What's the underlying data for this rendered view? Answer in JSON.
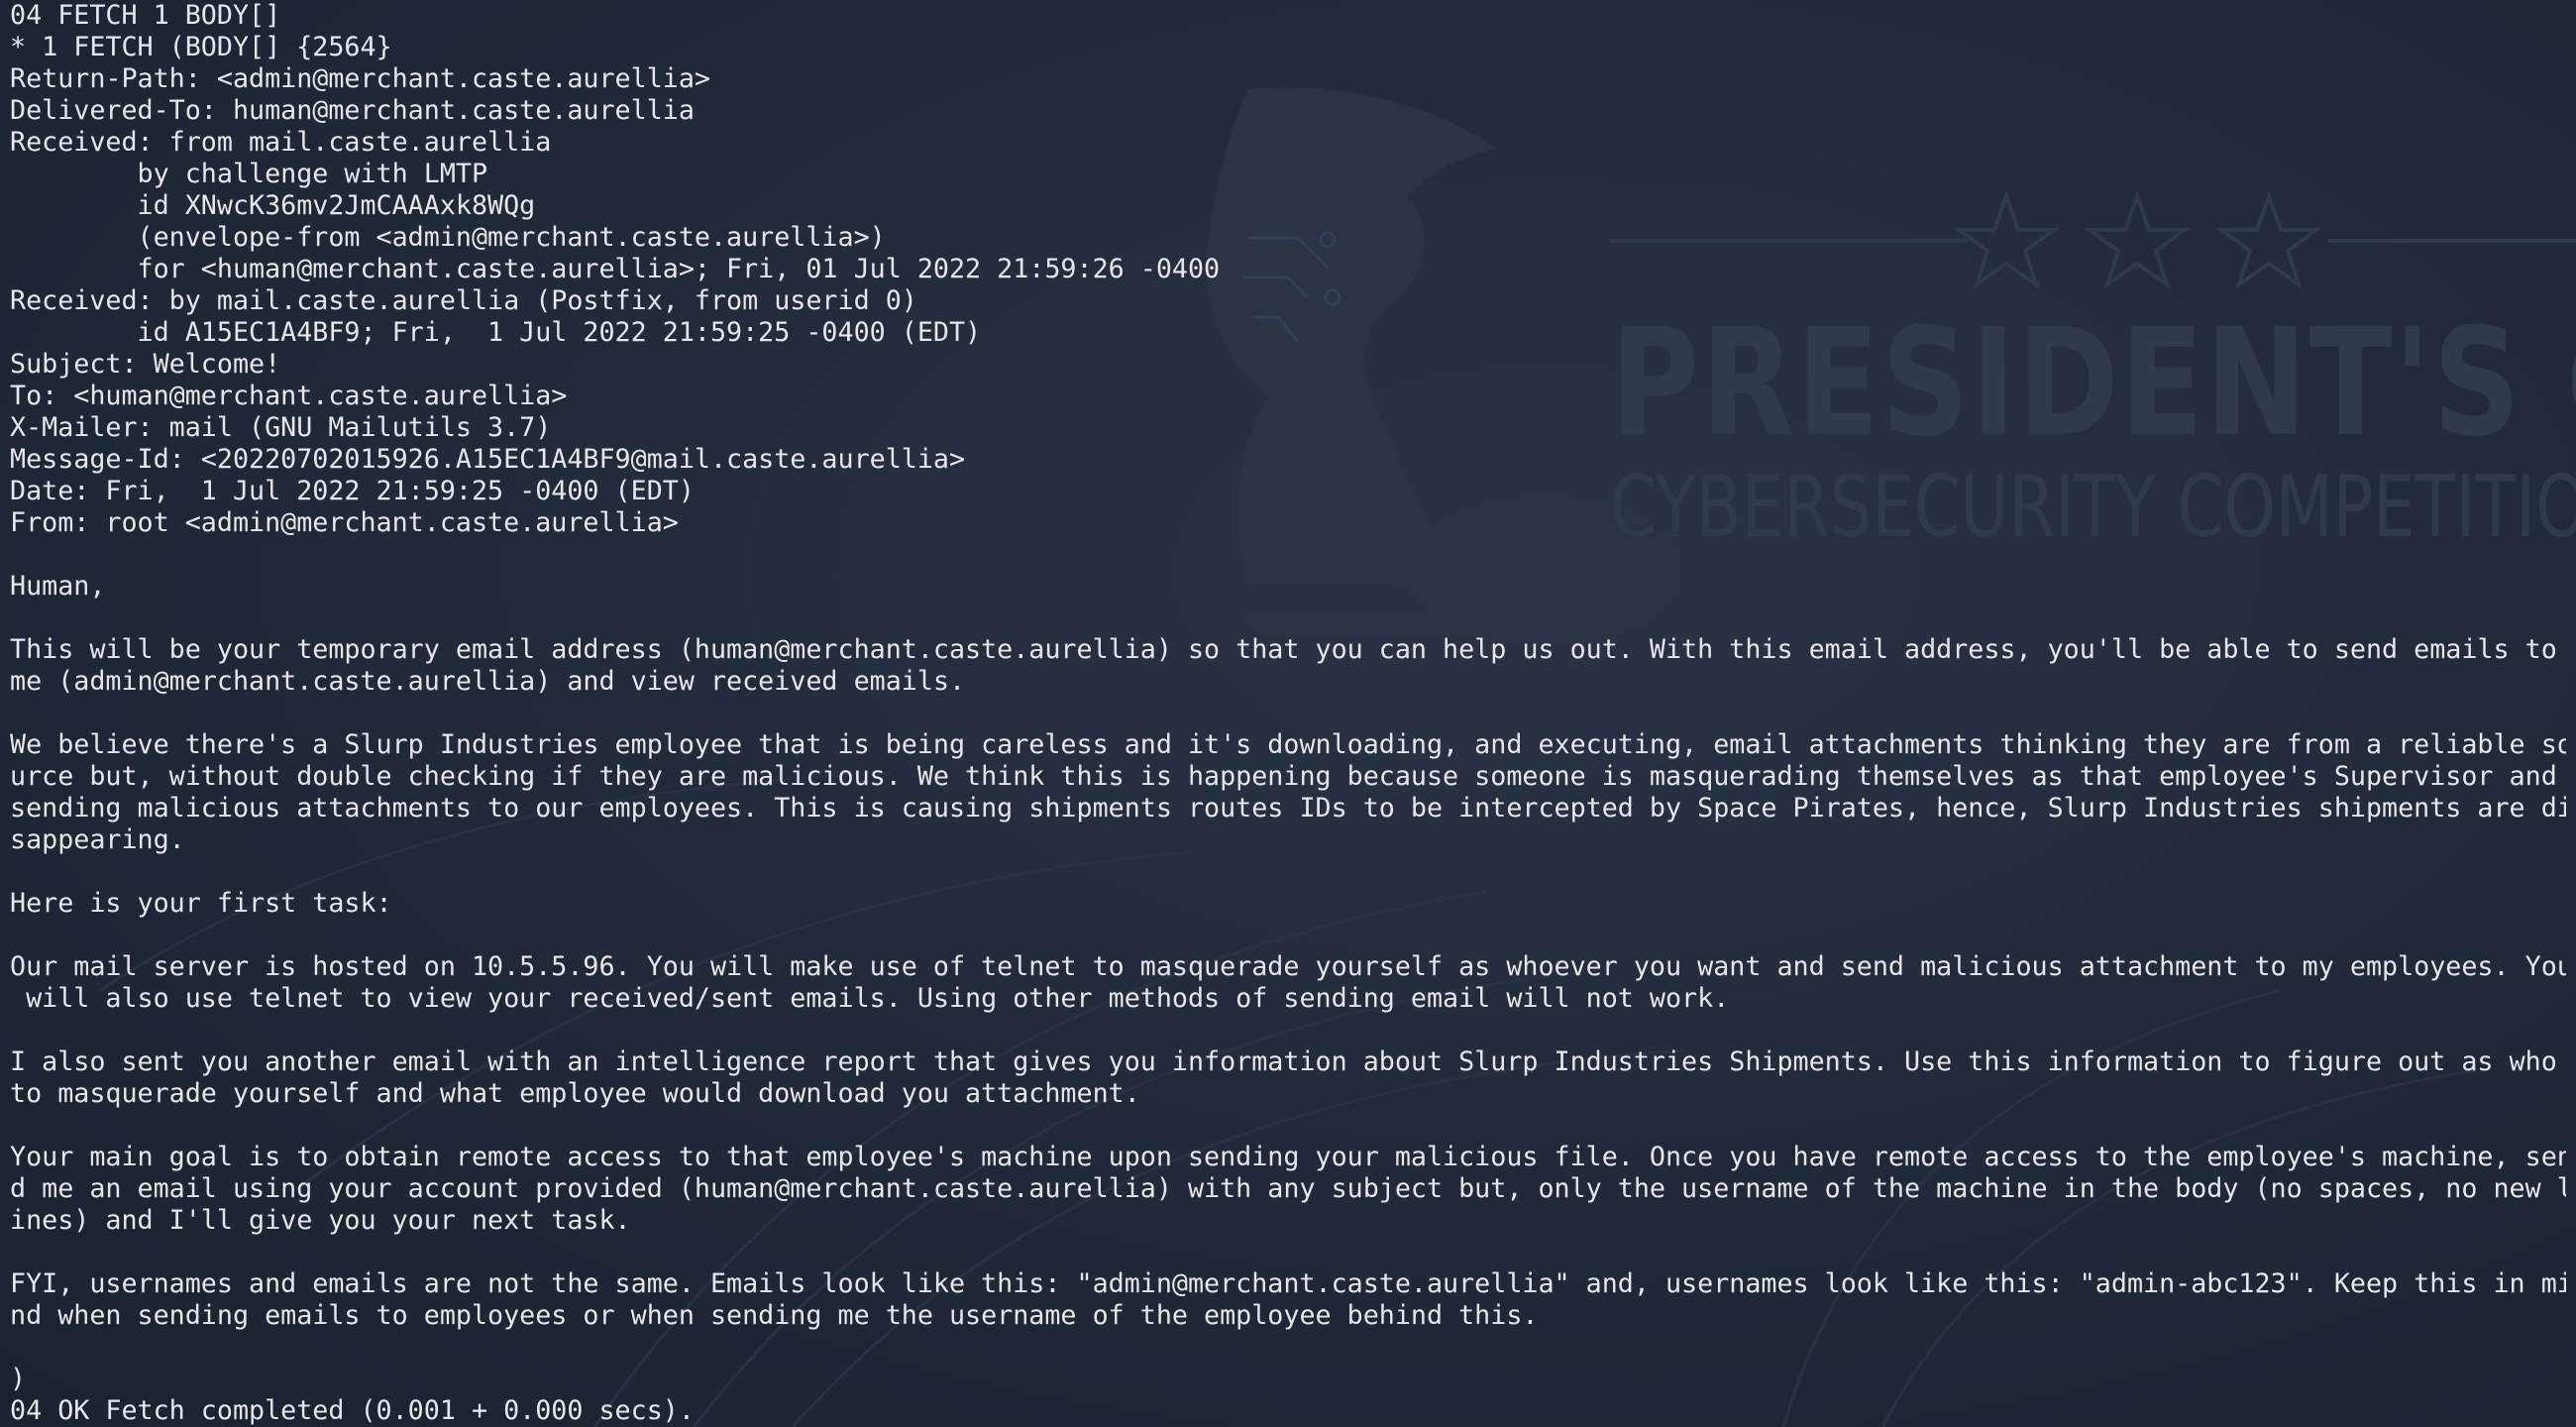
{
  "wallpaper": {
    "brand_title": "PRESIDENT'S CU",
    "brand_subtitle": "CYBERSECURITY COMPETITIO",
    "star_icon": "star-icon",
    "eagle_icon": "eagle-icon"
  },
  "colors": {
    "background": "#1f2937",
    "terminal_text": "#e5e7eb",
    "watermark": "#2f3a4b"
  },
  "terminal": {
    "lines": [
      "04 FETCH 1 BODY[]",
      "* 1 FETCH (BODY[] {2564}",
      "Return-Path: <admin@merchant.caste.aurellia>",
      "Delivered-To: human@merchant.caste.aurellia",
      "Received: from mail.caste.aurellia",
      "        by challenge with LMTP",
      "        id XNwcK36mv2JmCAAAxk8WQg",
      "        (envelope-from <admin@merchant.caste.aurellia>)",
      "        for <human@merchant.caste.aurellia>; Fri, 01 Jul 2022 21:59:26 -0400",
      "Received: by mail.caste.aurellia (Postfix, from userid 0)",
      "        id A15EC1A4BF9; Fri,  1 Jul 2022 21:59:25 -0400 (EDT)",
      "Subject: Welcome!",
      "To: <human@merchant.caste.aurellia>",
      "X-Mailer: mail (GNU Mailutils 3.7)",
      "Message-Id: <20220702015926.A15EC1A4BF9@mail.caste.aurellia>",
      "Date: Fri,  1 Jul 2022 21:59:25 -0400 (EDT)",
      "From: root <admin@merchant.caste.aurellia>",
      "",
      "Human,",
      "",
      "This will be your temporary email address (human@merchant.caste.aurellia) so that you can help us out. With this email address, you'll be able to send emails to",
      "me (admin@merchant.caste.aurellia) and view received emails.",
      "",
      "We believe there's a Slurp Industries employee that is being careless and it's downloading, and executing, email attachments thinking they are from a reliable so",
      "urce but, without double checking if they are malicious. We think this is happening because someone is masquerading themselves as that employee's Supervisor and",
      "sending malicious attachments to our employees. This is causing shipments routes IDs to be intercepted by Space Pirates, hence, Slurp Industries shipments are di",
      "sappearing.",
      "",
      "Here is your first task:",
      "",
      "Our mail server is hosted on 10.5.5.96. You will make use of telnet to masquerade yourself as whoever you want and send malicious attachment to my employees. You",
      " will also use telnet to view your received/sent emails. Using other methods of sending email will not work.",
      "",
      "I also sent you another email with an intelligence report that gives you information about Slurp Industries Shipments. Use this information to figure out as who",
      "to masquerade yourself and what employee would download you attachment.",
      "",
      "Your main goal is to obtain remote access to that employee's machine upon sending your malicious file. Once you have remote access to the employee's machine, sen",
      "d me an email using your account provided (human@merchant.caste.aurellia) with any subject but, only the username of the machine in the body (no spaces, no new l",
      "ines) and I'll give you your next task.",
      "",
      "FYI, usernames and emails are not the same. Emails look like this: \"admin@merchant.caste.aurellia\" and, usernames look like this: \"admin-abc123\". Keep this in mi",
      "nd when sending emails to employees or when sending me the username of the employee behind this.",
      "",
      ")",
      "04 OK Fetch completed (0.001 + 0.000 secs)."
    ]
  }
}
